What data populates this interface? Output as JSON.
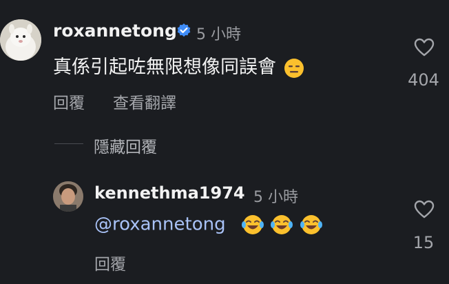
{
  "comment": {
    "username": "roxannetong",
    "verified": true,
    "time": "5 小時",
    "text": "真係引起咗無限想像同誤會",
    "emoji": "expressionless-face",
    "reply_label": "回覆",
    "translate_label": "查看翻譯",
    "like_count": "404"
  },
  "hide_replies_label": "隱藏回覆",
  "reply": {
    "username": "kennethma1974",
    "time": "5 小時",
    "mention": "@roxannetong",
    "emojis": [
      "face-with-tears-of-joy",
      "face-with-tears-of-joy",
      "face-with-tears-of-joy"
    ],
    "reply_label": "回覆",
    "like_count": "15"
  },
  "colors": {
    "background": "#1b1d21",
    "verified_badge": "#3f8cf7",
    "mention": "#a9c2f7",
    "secondary_text": "#a4a6ab"
  }
}
